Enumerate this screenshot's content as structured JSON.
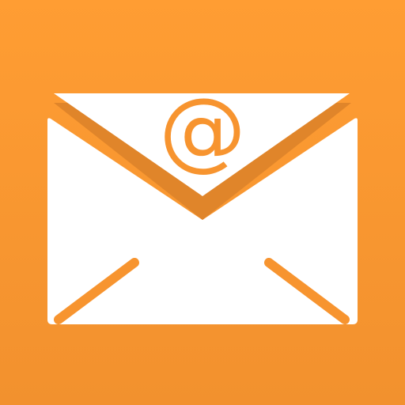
{
  "icon": {
    "symbol": "@",
    "icon_name": "mail-icon",
    "colors": {
      "background_top": "#FF9D33",
      "background_bottom": "#F2912E",
      "envelope": "#FFFFFF",
      "flap_shadow": "#E0852A",
      "accent": "#F7942F"
    }
  }
}
